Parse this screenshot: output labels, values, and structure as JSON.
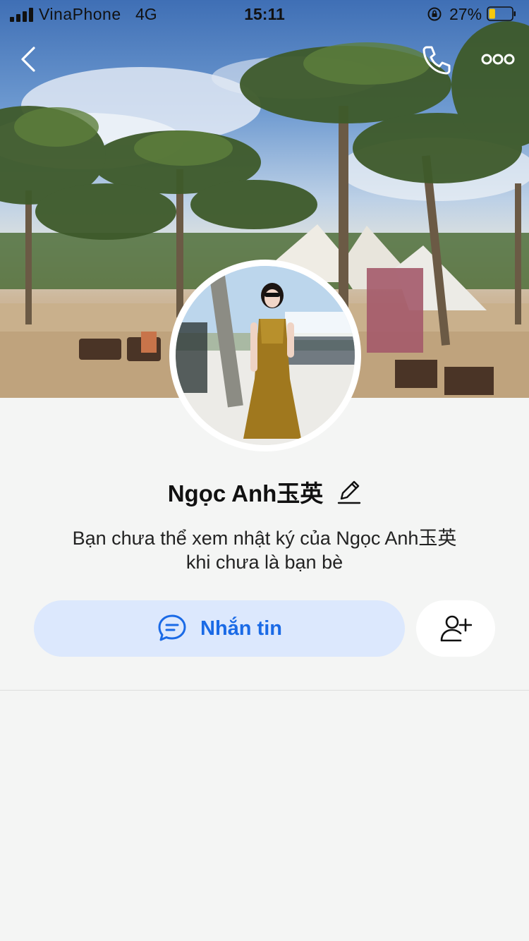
{
  "status_bar": {
    "carrier": "VinaPhone",
    "network": "4G",
    "time": "15:11",
    "battery_percent": "27%",
    "battery_level": 0.27,
    "battery_color": "#f6c90e"
  },
  "nav": {
    "back_icon": "chevron-left-icon",
    "call_icon": "phone-icon",
    "more_icon": "more-dots-icon"
  },
  "profile": {
    "name": "Ngọc Anh玉英",
    "edit_icon": "pencil-icon",
    "notice_line1": "Bạn chưa thể xem nhật ký của Ngọc Anh玉英",
    "notice_line2": "khi chưa là bạn bè"
  },
  "actions": {
    "message_label": "Nhắn tin",
    "message_icon": "chat-bubble-icon",
    "add_friend_icon": "add-friend-icon"
  },
  "colors": {
    "accent": "#1a6ae6",
    "message_button_bg": "#dce8fd",
    "page_bg": "#f4f5f4"
  }
}
